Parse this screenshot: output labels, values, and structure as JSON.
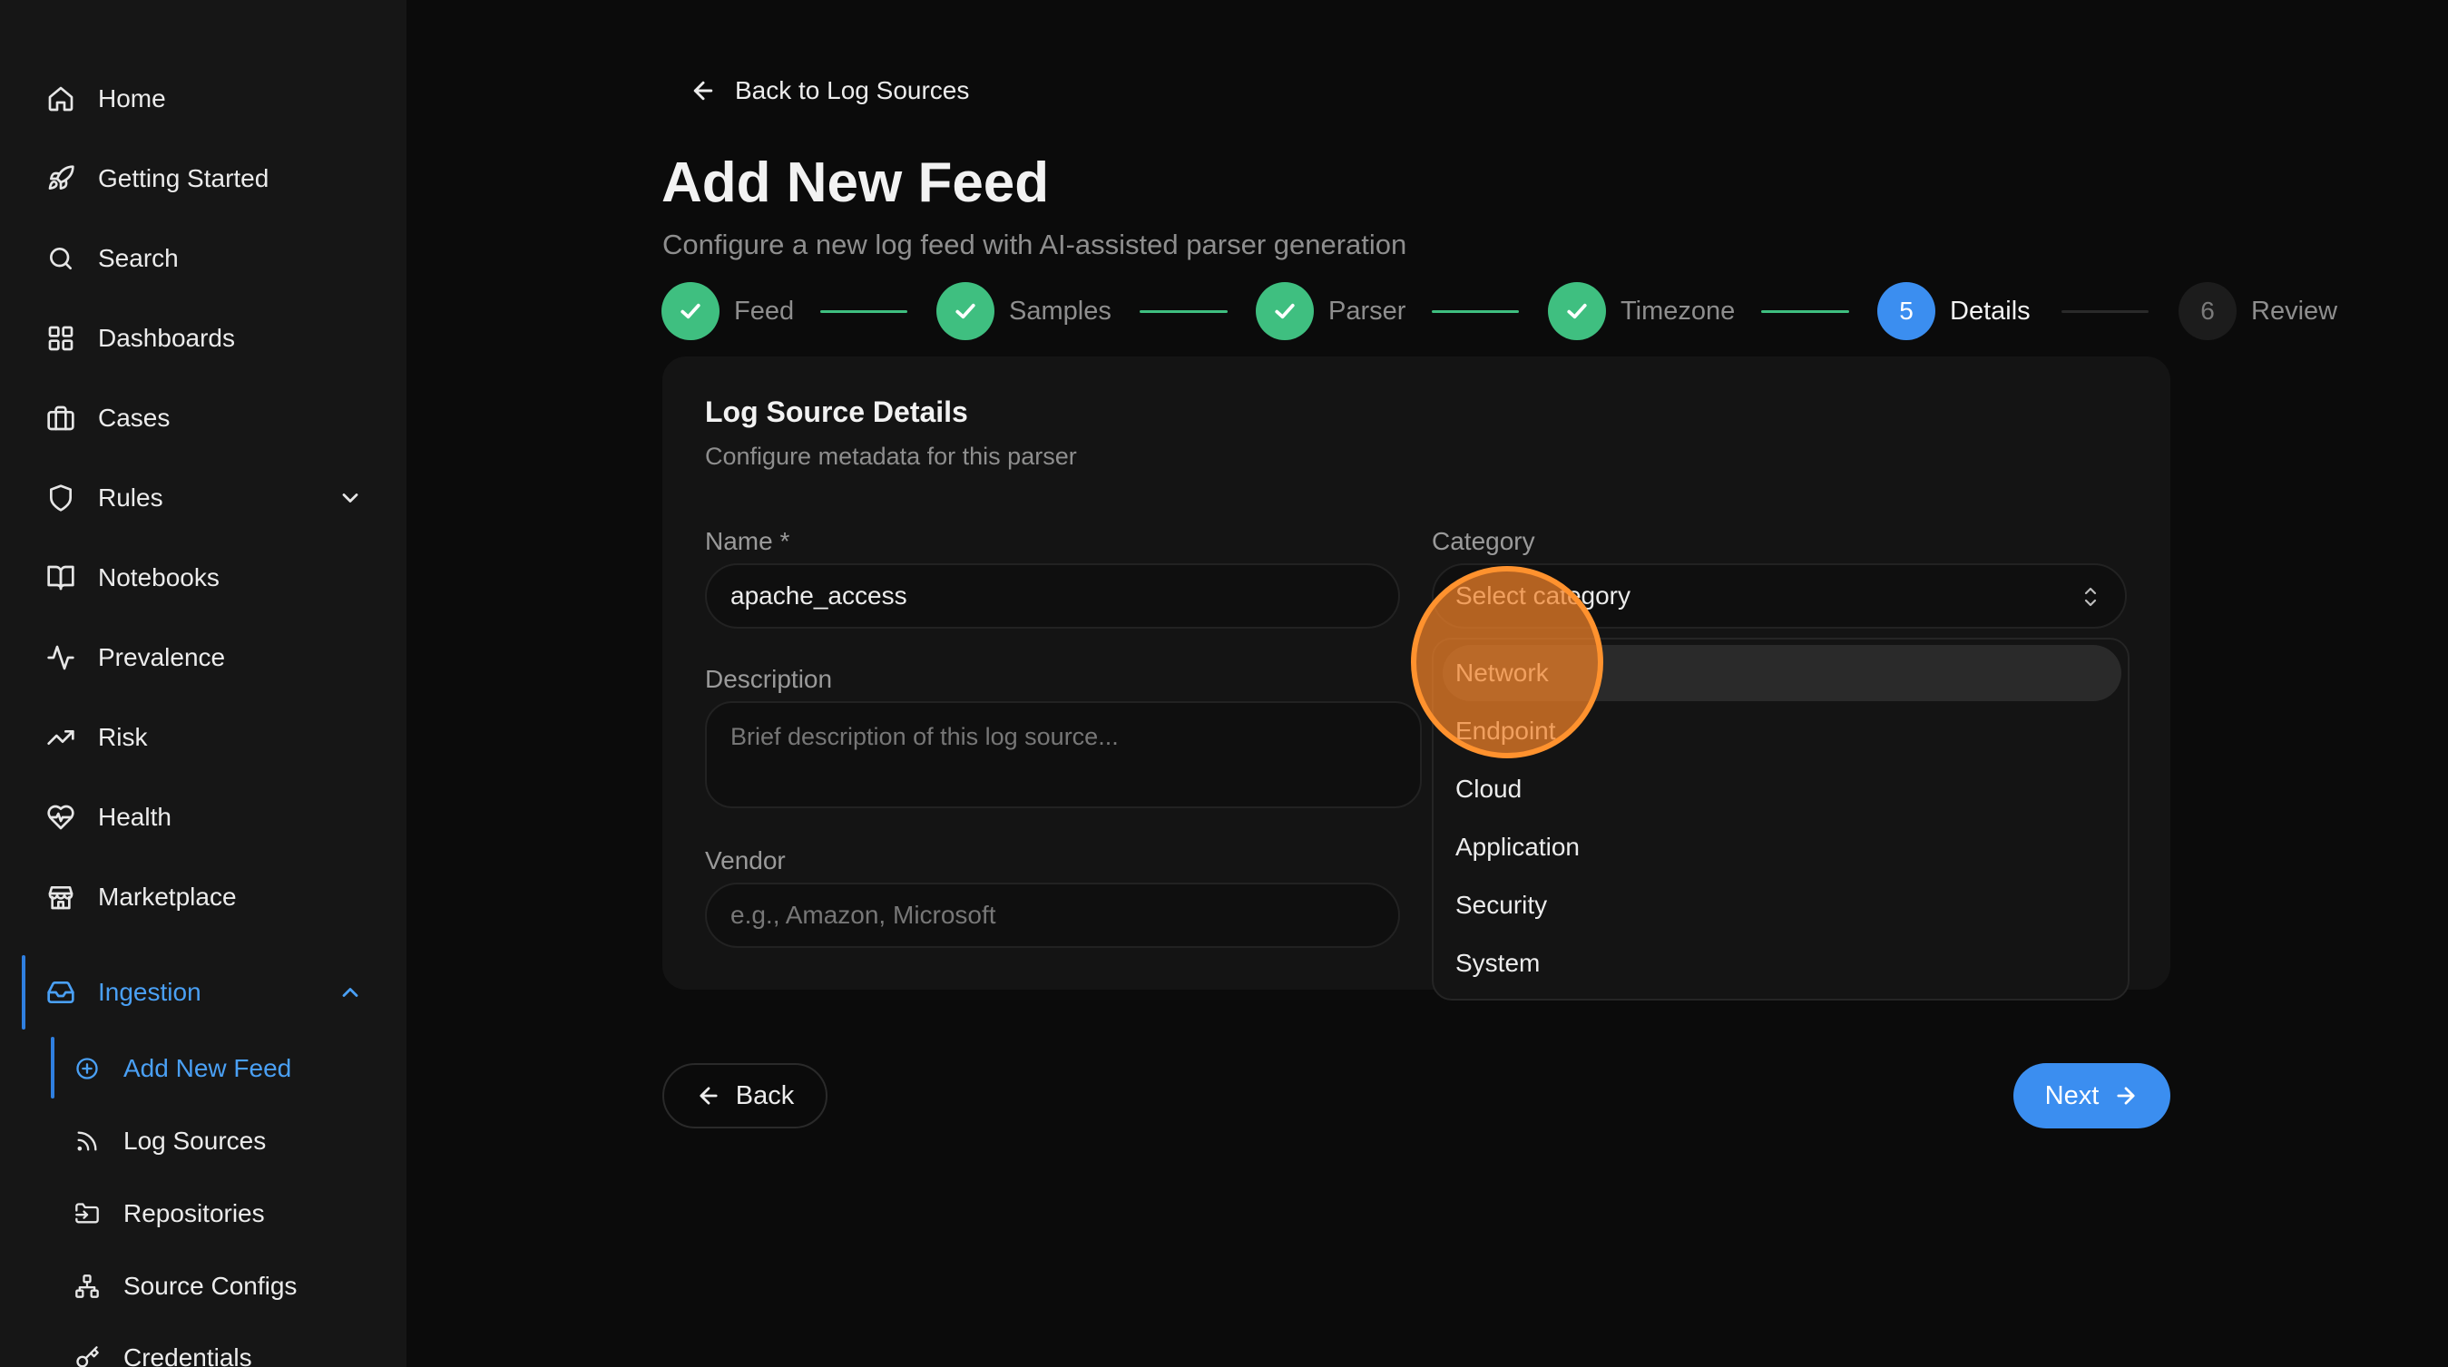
{
  "sidebar": {
    "items": [
      {
        "label": "Home",
        "icon": "home-icon"
      },
      {
        "label": "Getting Started",
        "icon": "rocket-icon"
      },
      {
        "label": "Search",
        "icon": "search-icon"
      },
      {
        "label": "Dashboards",
        "icon": "grid-icon"
      },
      {
        "label": "Cases",
        "icon": "briefcase-icon"
      },
      {
        "label": "Rules",
        "icon": "shield-icon"
      },
      {
        "label": "Notebooks",
        "icon": "book-icon"
      },
      {
        "label": "Prevalence",
        "icon": "activity-icon"
      },
      {
        "label": "Risk",
        "icon": "trending-up-icon"
      },
      {
        "label": "Health",
        "icon": "heart-pulse-icon"
      },
      {
        "label": "Marketplace",
        "icon": "store-icon"
      },
      {
        "label": "Ingestion",
        "icon": "inbox-icon"
      }
    ],
    "ingestion_sub": [
      {
        "label": "Add New Feed",
        "icon": "plus-circle-icon"
      },
      {
        "label": "Log Sources",
        "icon": "rss-icon"
      },
      {
        "label": "Repositories",
        "icon": "folder-input-icon"
      },
      {
        "label": "Source Configs",
        "icon": "network-icon"
      },
      {
        "label": "Credentials",
        "icon": "key-icon"
      }
    ],
    "accent_color": "#4aa0f5"
  },
  "header": {
    "back_link": "Back to Log Sources",
    "title": "Add New Feed",
    "subtitle": "Configure a new log feed with AI-assisted parser generation"
  },
  "stepper": {
    "steps": [
      {
        "label": "Feed",
        "state": "done"
      },
      {
        "label": "Samples",
        "state": "done"
      },
      {
        "label": "Parser",
        "state": "done"
      },
      {
        "label": "Timezone",
        "state": "done"
      },
      {
        "label": "Details",
        "number": "5",
        "state": "current"
      },
      {
        "label": "Review",
        "number": "6",
        "state": "pending"
      }
    ],
    "done_color": "#3fbf80",
    "current_color": "#3b8ef0"
  },
  "form": {
    "card_title": "Log Source Details",
    "card_subtitle": "Configure metadata for this parser",
    "name_label": "Name *",
    "name_value": "apache_access",
    "category_label": "Category",
    "category_placeholder": "Select category",
    "description_label": "Description",
    "description_placeholder": "Brief description of this log source...",
    "vendor_label": "Vendor",
    "vendor_placeholder": "e.g., Amazon, Microsoft",
    "category_options": [
      "Network",
      "Endpoint",
      "Cloud",
      "Application",
      "Security",
      "System"
    ],
    "highlighted_option": "Network"
  },
  "footer": {
    "back_label": "Back",
    "next_label": "Next"
  }
}
